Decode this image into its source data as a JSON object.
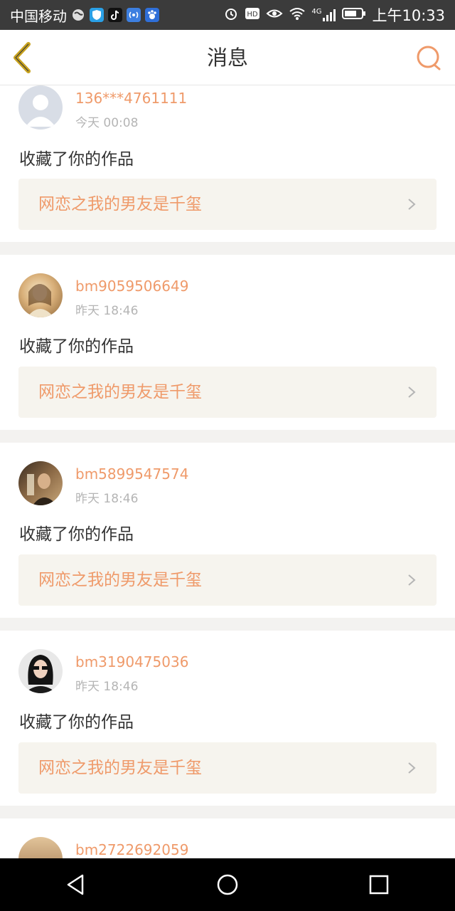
{
  "status_bar": {
    "carrier": "中国移动",
    "network": "4G",
    "time": "上午10:33"
  },
  "header": {
    "title": "消息"
  },
  "messages": [
    {
      "username": "136***4761111",
      "time": "今天 00:08",
      "action": "收藏了你的作品",
      "work_title": "网恋之我的男友是千玺",
      "avatar": "default-avatar"
    },
    {
      "username": "bm9059506649",
      "time": "昨天 18:46",
      "action": "收藏了你的作品",
      "work_title": "网恋之我的男友是千玺",
      "avatar": "user-photo-avatar"
    },
    {
      "username": "bm5899547574",
      "time": "昨天 18:46",
      "action": "收藏了你的作品",
      "work_title": "网恋之我的男友是千玺",
      "avatar": "user-photo-avatar"
    },
    {
      "username": "bm3190475036",
      "time": "昨天 18:46",
      "action": "收藏了你的作品",
      "work_title": "网恋之我的男友是千玺",
      "avatar": "user-photo-avatar"
    },
    {
      "username": "bm2722692059",
      "avatar": "user-photo-avatar"
    }
  ],
  "colors": {
    "accent": "#ef9a6a",
    "back_arrow": "#c8a21e"
  },
  "icons": {
    "back": "back-arrow-icon",
    "search": "search-icon",
    "chevron": "chevron-right-icon",
    "nav": [
      "back-triangle-icon",
      "home-circle-icon",
      "recents-square-icon"
    ]
  }
}
